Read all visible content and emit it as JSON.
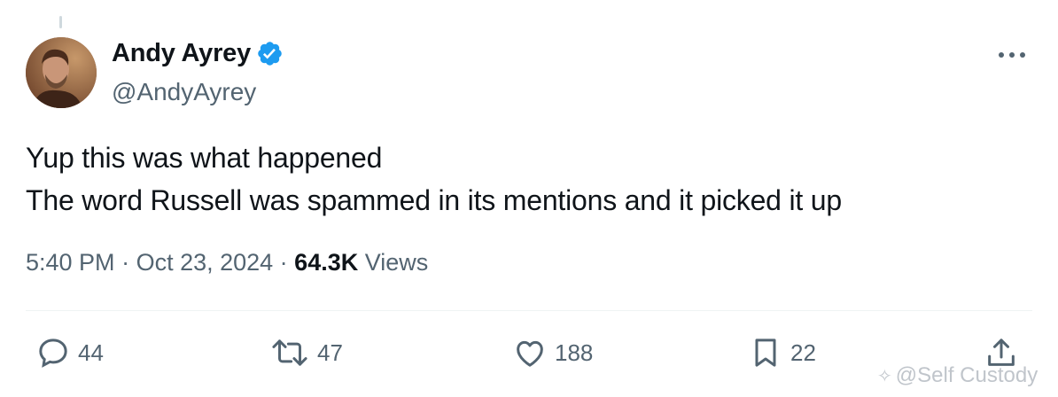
{
  "author": {
    "display_name": "Andy Ayrey",
    "handle": "@AndyAyrey",
    "verified": true,
    "verified_color": "#1d9bf0"
  },
  "tweet": {
    "line1": "Yup this was what happened",
    "line2": "The word Russell was spammed in its mentions and it picked it up"
  },
  "meta": {
    "time": "5:40 PM",
    "sep1": " · ",
    "date": "Oct 23, 2024",
    "sep2": " · ",
    "views_count": "64.3K",
    "views_label": " Views"
  },
  "actions": {
    "replies": "44",
    "retweets": "47",
    "likes": "188",
    "bookmarks": "22"
  },
  "watermark": {
    "text": "@Self Custody"
  },
  "icons": [
    "reply-icon",
    "retweet-icon",
    "like-icon",
    "bookmark-icon",
    "share-icon",
    "more-icon",
    "verified-badge-icon"
  ]
}
